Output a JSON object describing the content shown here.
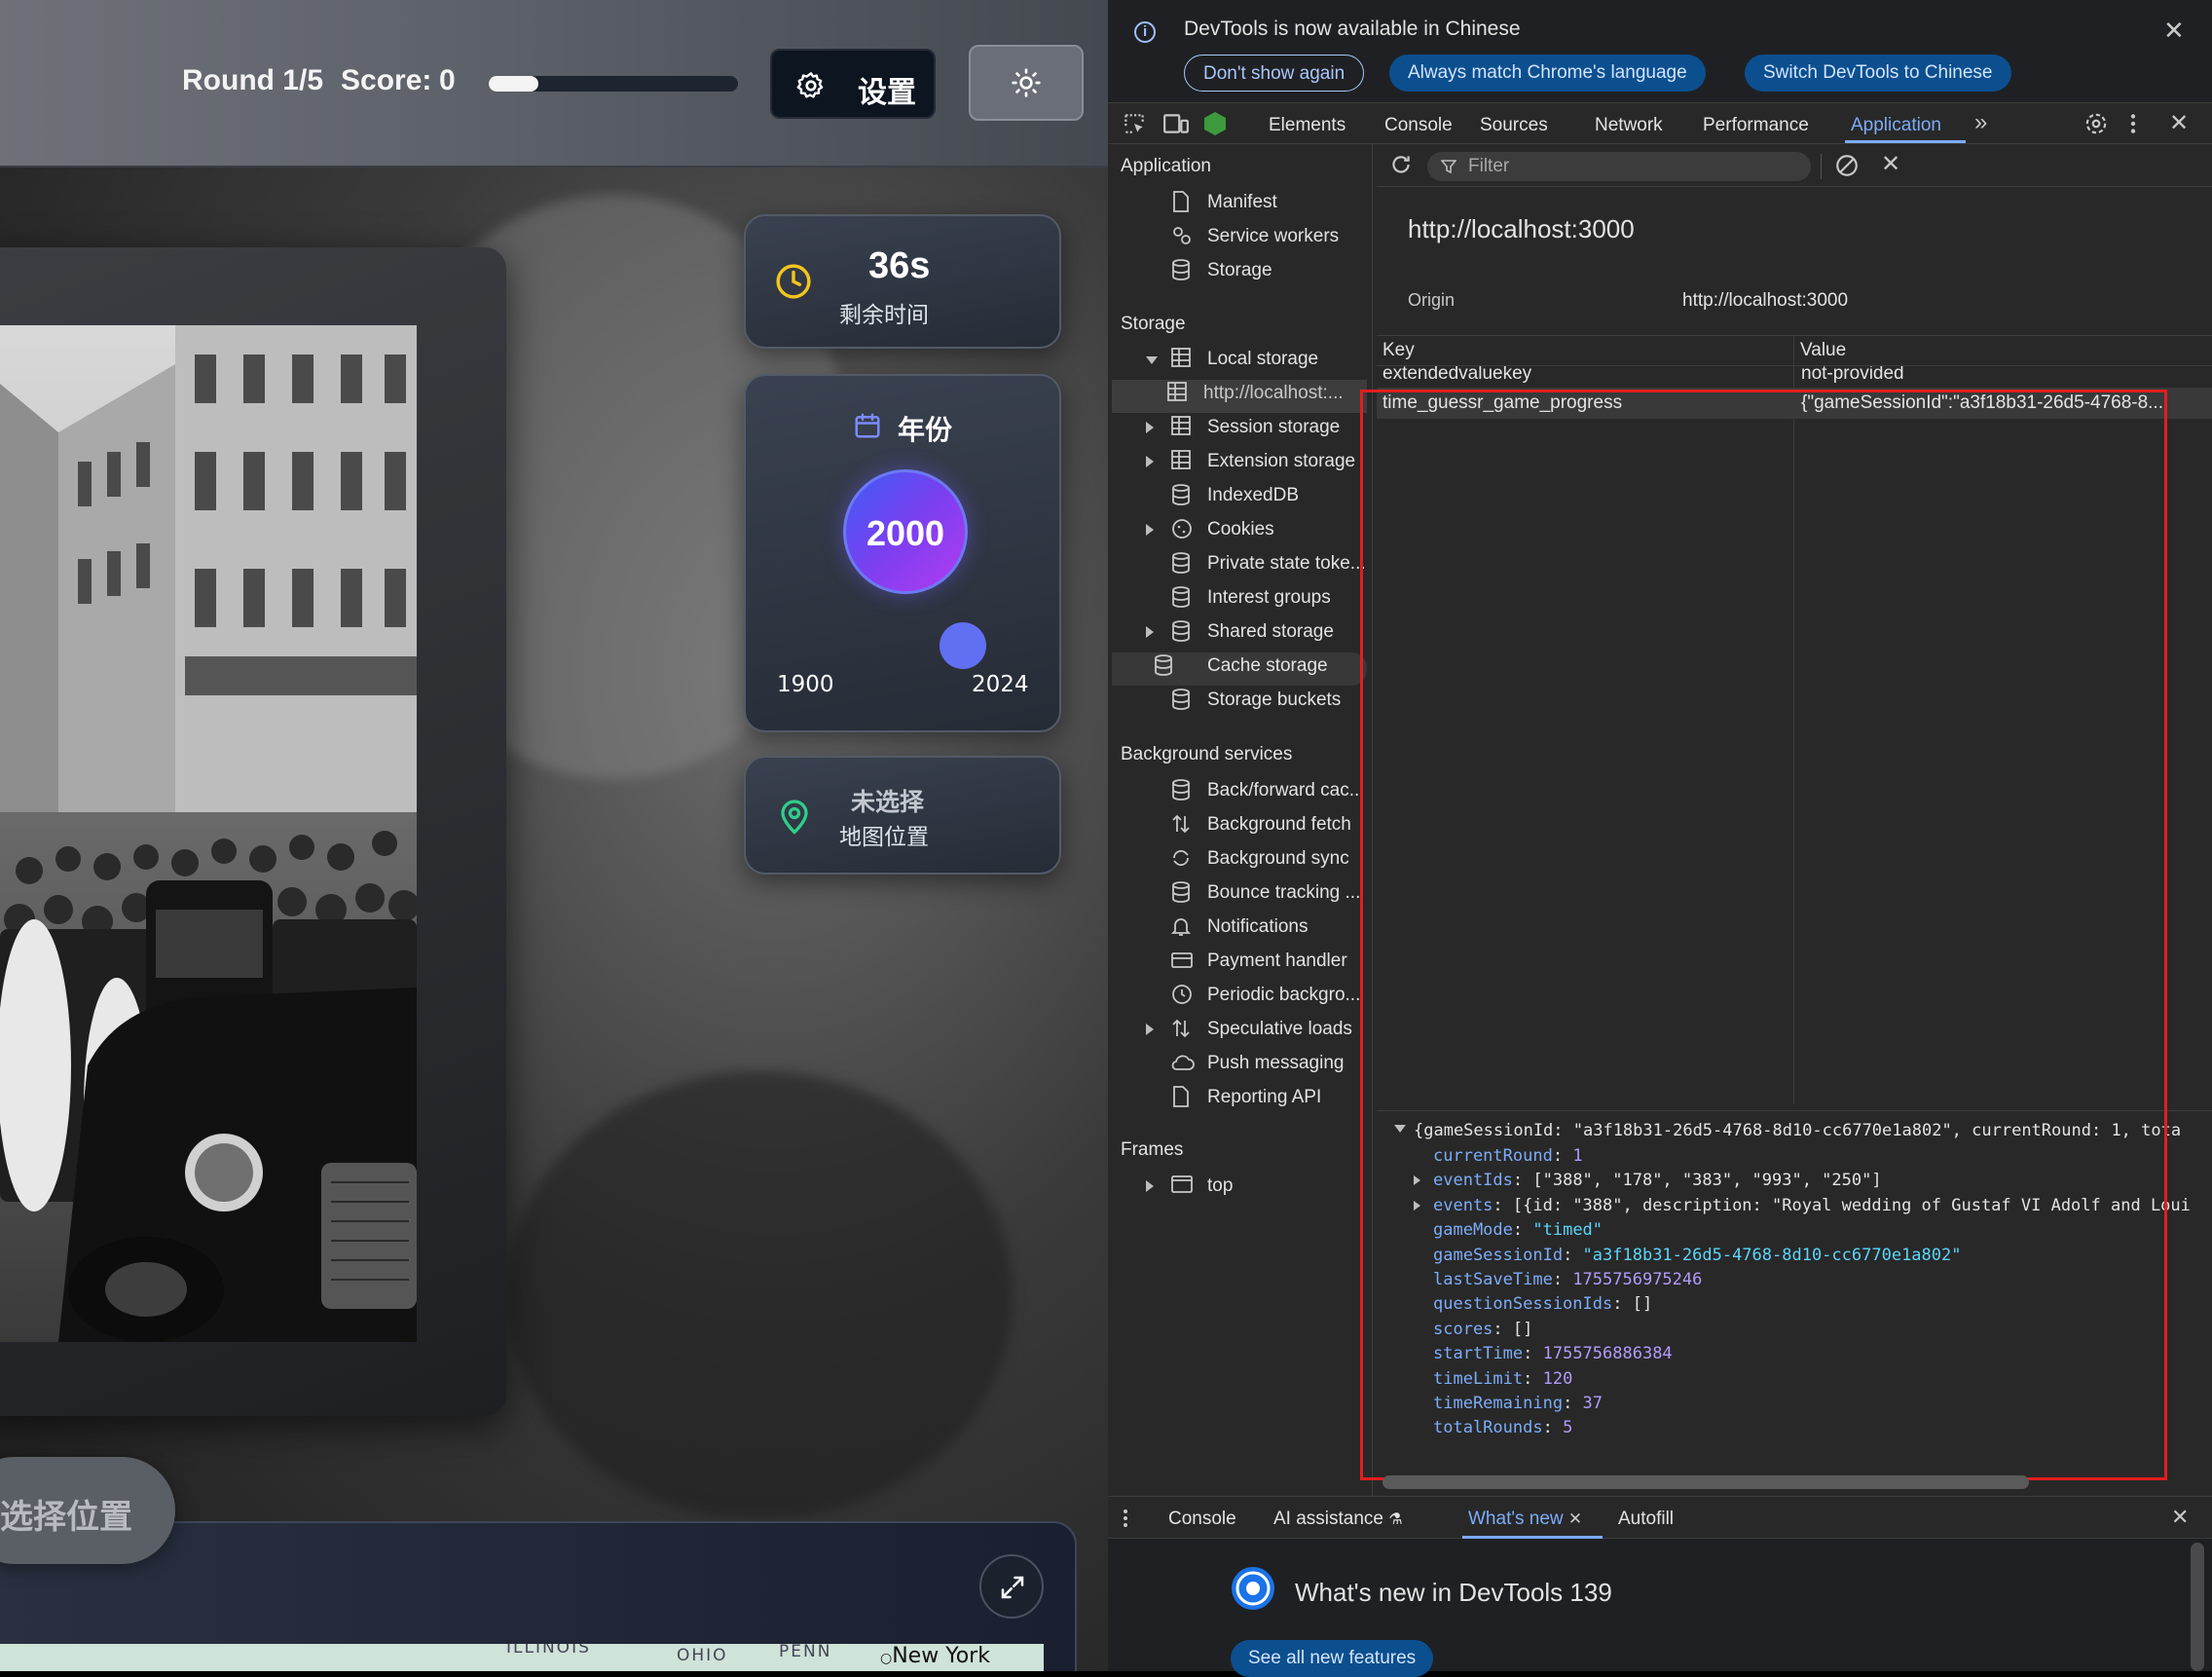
{
  "app": {
    "round_text": "Round 1/5",
    "score_label": "Score:",
    "score_value": "0",
    "progress_fraction": 0.2,
    "settings_label": "设置",
    "timer_value": "36s",
    "timer_label": "剩余时间",
    "year_label": "年份",
    "year_value": "2000",
    "year_min": "1900",
    "year_max": "2024",
    "location_title": "未选择",
    "location_sub": "地图位置",
    "select_pill_text": "选择位置",
    "map_labels": [
      "ILLINOIS",
      "OHIO",
      "PENN",
      "New York"
    ]
  },
  "devtools": {
    "infobar": {
      "message": "DevTools is now available in Chinese",
      "btn_dont_show": "Don't show again",
      "btn_always_match": "Always match Chrome's language",
      "btn_switch": "Switch DevTools to Chinese"
    },
    "tabs": [
      "Elements",
      "Console",
      "Sources",
      "Network",
      "Performance",
      "Application"
    ],
    "active_tab": "Application",
    "sidebar": {
      "application_header": "Application",
      "application_items": [
        "Manifest",
        "Service workers",
        "Storage"
      ],
      "storage_header": "Storage",
      "storage_items": [
        "Local storage",
        "http://localhost:...",
        "Session storage",
        "Extension storage",
        "IndexedDB",
        "Cookies",
        "Private state toke...",
        "Interest groups",
        "Shared storage",
        "Cache storage",
        "Storage buckets"
      ],
      "background_header": "Background services",
      "background_items": [
        "Back/forward cac...",
        "Background fetch",
        "Background sync",
        "Bounce tracking ...",
        "Notifications",
        "Payment handler",
        "Periodic backgro...",
        "Speculative loads",
        "Push messaging",
        "Reporting API"
      ],
      "frames_header": "Frames",
      "frames_items": [
        "top"
      ]
    },
    "filter_placeholder": "Filter",
    "origin_title": "http://localhost:3000",
    "origin_label": "Origin",
    "origin_value": "http://localhost:3000",
    "table": {
      "headers": [
        "Key",
        "Value"
      ],
      "rows": [
        {
          "key": "extendedvaluekey",
          "value": "not-provided"
        },
        {
          "key": "time_guessr_game_progress",
          "value": "{\"gameSessionId\":\"a3f18b31-26d5-4768-8..."
        }
      ]
    },
    "preview": {
      "summary": "{gameSessionId: \"a3f18b31-26d5-4768-8d10-cc6770e1a802\", currentRound: 1, tota",
      "lines": [
        {
          "key": "currentRound",
          "value": "1",
          "kind": "num",
          "expandable": false
        },
        {
          "key": "eventIds",
          "value": "[\"388\", \"178\", \"383\", \"993\", \"250\"]",
          "kind": "plain",
          "expandable": true
        },
        {
          "key": "events",
          "value": "[{id: \"388\", description: \"Royal wedding of Gustaf VI Adolf and Loui",
          "kind": "plain",
          "expandable": true
        },
        {
          "key": "gameMode",
          "value": "\"timed\"",
          "kind": "str",
          "expandable": false
        },
        {
          "key": "gameSessionId",
          "value": "\"a3f18b31-26d5-4768-8d10-cc6770e1a802\"",
          "kind": "str",
          "expandable": false
        },
        {
          "key": "lastSaveTime",
          "value": "1755756975246",
          "kind": "num",
          "expandable": false
        },
        {
          "key": "questionSessionIds",
          "value": "[]",
          "kind": "plain",
          "expandable": false
        },
        {
          "key": "scores",
          "value": "[]",
          "kind": "plain",
          "expandable": false
        },
        {
          "key": "startTime",
          "value": "1755756886384",
          "kind": "num",
          "expandable": false
        },
        {
          "key": "timeLimit",
          "value": "120",
          "kind": "num",
          "expandable": false
        },
        {
          "key": "timeRemaining",
          "value": "37",
          "kind": "num",
          "expandable": false
        },
        {
          "key": "totalRounds",
          "value": "5",
          "kind": "num",
          "expandable": false
        }
      ]
    },
    "drawer_tabs": [
      "Console",
      "AI assistance",
      "What's new",
      "Autofill"
    ],
    "whats_new_title": "What's new in DevTools 139",
    "whats_new_button": "See all new features",
    "colors": {
      "accent": "#7cacf8",
      "highlight_box": "#e21e1e",
      "button_bg": "#0c4f8f"
    }
  }
}
